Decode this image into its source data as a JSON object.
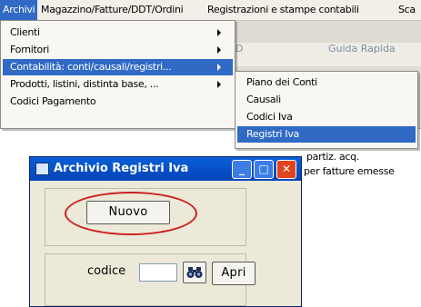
{
  "menubar": {
    "items": [
      {
        "label": "Archivi"
      },
      {
        "label": "Magazzino/Fatture/DDT/Ordini"
      },
      {
        "label": "Registrazioni e stampe contabili"
      },
      {
        "label": "Sca"
      }
    ]
  },
  "toolbar": {
    "partial_label": "D",
    "guide_label": "Guida Rapida"
  },
  "archivi_menu": {
    "items": [
      {
        "label": "Clienti"
      },
      {
        "label": "Fornitori"
      },
      {
        "label": "Contabilità: conti/causali/registri..."
      },
      {
        "label": "Prodotti, listini, distinta base, ..."
      },
      {
        "label": "Codici Pagamento"
      }
    ]
  },
  "contabilita_submenu": {
    "items": [
      {
        "label": "Piano dei Conti"
      },
      {
        "label": "Causali"
      },
      {
        "label": "Codici Iva"
      },
      {
        "label": "Registri Iva"
      }
    ]
  },
  "background_text": {
    "line1": "partiz. acq.",
    "line2": "per fatture emesse"
  },
  "dialog": {
    "title": "Archivio Registri Iva",
    "minimize": "_",
    "maximize": "□",
    "close": "✕",
    "nuovo_label": "Nuovo",
    "codice_label": "codice",
    "codice_value": "",
    "search_icon": "binoculars-icon",
    "apri_label": "Apri"
  },
  "colors": {
    "highlight": "#316ac5",
    "title_bar": "#0443b8",
    "annotation": "#cc1f1f"
  }
}
